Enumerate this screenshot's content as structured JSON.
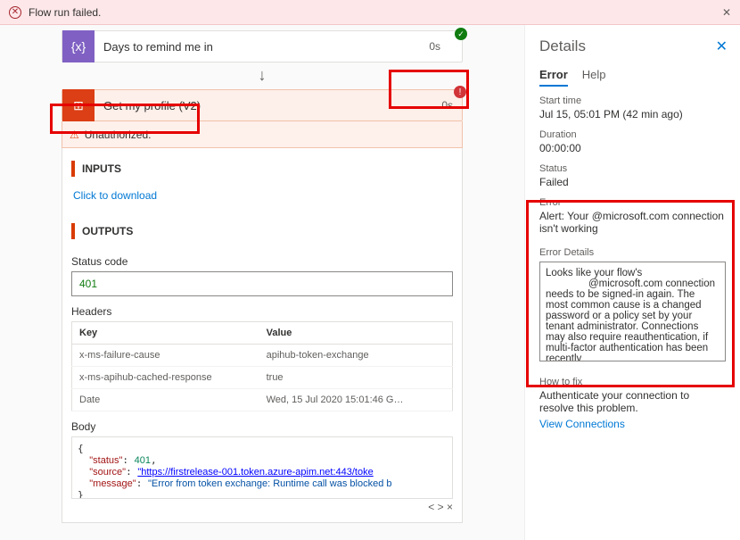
{
  "alert": {
    "text": "Flow run failed."
  },
  "step1": {
    "title": "Days to remind me in",
    "time": "0s"
  },
  "step2": {
    "title": "Get my profile (V2)",
    "time": "0s",
    "unauth": "Unauthorized."
  },
  "inputs": {
    "heading": "INPUTS",
    "download": "Click to download"
  },
  "outputs": {
    "heading": "OUTPUTS",
    "status_label": "Status code",
    "status_value": "401",
    "headers_label": "Headers",
    "th_key": "Key",
    "th_value": "Value",
    "rows": [
      {
        "k": "x-ms-failure-cause",
        "v": "apihub-token-exchange"
      },
      {
        "k": "x-ms-apihub-cached-response",
        "v": "true"
      },
      {
        "k": "Date",
        "v": "Wed, 15 Jul 2020 15:01:46 G…"
      }
    ],
    "body_label": "Body",
    "body_status": "\"status\"",
    "body_status_v": "401",
    "body_source": "\"source\"",
    "body_source_v": "\"https://firstrelease-001.token.azure-apim.net:443/toke",
    "body_message": "\"message\"",
    "body_message_v": "\"Error from token exchange: Runtime call was blocked b",
    "nav": "<  > ×"
  },
  "details": {
    "title": "Details",
    "tabs": {
      "error": "Error",
      "help": "Help"
    },
    "start_lbl": "Start time",
    "start_val": "Jul 15, 05:01 PM (42 min ago)",
    "dur_lbl": "Duration",
    "dur_val": "00:00:00",
    "status_lbl": "Status",
    "status_val": "Failed",
    "err_lbl": "Error",
    "err_val": "Alert: Your            @microsoft.com connection isn't working",
    "errdet_lbl": "Error Details",
    "errdet_val": "Looks like your flow's\n               @microsoft.com connection needs to be signed-in again. The most common cause is a changed password or a policy set by your tenant administrator. Connections may also require reauthentication, if multi-factor authentication has been recently",
    "fix_lbl": "How to fix",
    "fix_val": "Authenticate your connection to resolve this problem.",
    "view": "View Connections"
  }
}
